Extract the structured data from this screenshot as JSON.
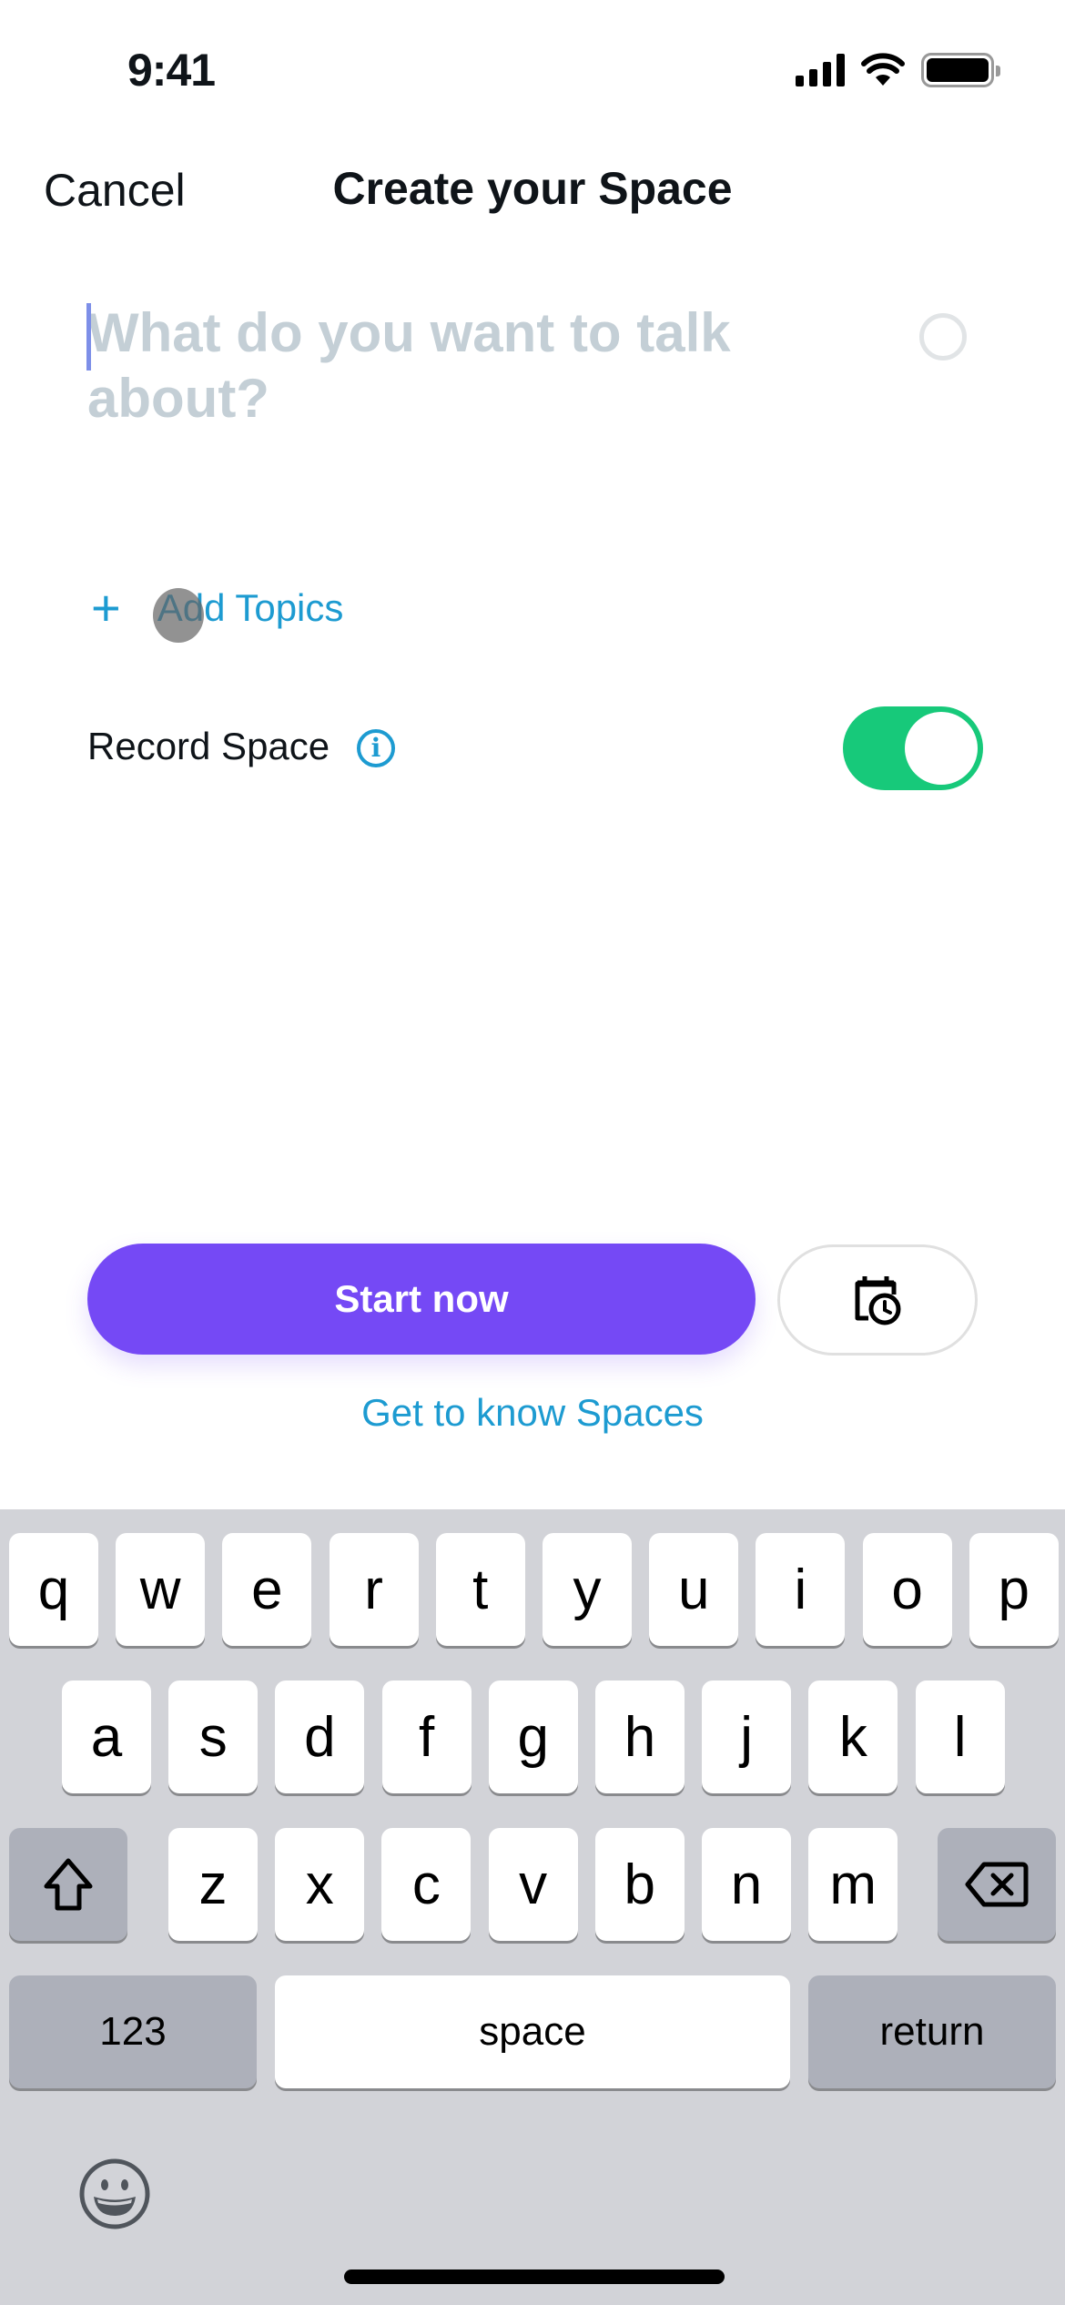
{
  "status_bar": {
    "time": "9:41",
    "icons": [
      "cellular-signal-icon",
      "wifi-icon",
      "battery-icon"
    ]
  },
  "nav": {
    "cancel_label": "Cancel",
    "title": "Create your Space"
  },
  "compose": {
    "placeholder": "What do you want to talk about?",
    "value": "",
    "character-counter-icon": "progress-ring"
  },
  "topics": {
    "add_label": "Add Topics",
    "icon": "plus-icon"
  },
  "record": {
    "label": "Record Space",
    "info_icon": "info-icon",
    "enabled": true
  },
  "actions": {
    "start_label": "Start now",
    "schedule_icon": "calendar-clock-icon",
    "learn_link": "Get to know Spaces"
  },
  "colors": {
    "accent_purple": "#7549f5",
    "link_blue": "#1d9bd1",
    "toggle_green": "#17c97a",
    "placeholder_gray": "#c4cfd6",
    "keyboard_bg": "#d2d3d8"
  },
  "keyboard": {
    "row1": [
      "q",
      "w",
      "e",
      "r",
      "t",
      "y",
      "u",
      "i",
      "o",
      "p"
    ],
    "row2": [
      "a",
      "s",
      "d",
      "f",
      "g",
      "h",
      "j",
      "k",
      "l"
    ],
    "row3": [
      "z",
      "x",
      "c",
      "v",
      "b",
      "n",
      "m"
    ],
    "shift_icon": "shift-icon",
    "delete_icon": "delete-icon",
    "numbers_label": "123",
    "space_label": "space",
    "return_label": "return",
    "emoji_icon": "emoji-icon"
  }
}
